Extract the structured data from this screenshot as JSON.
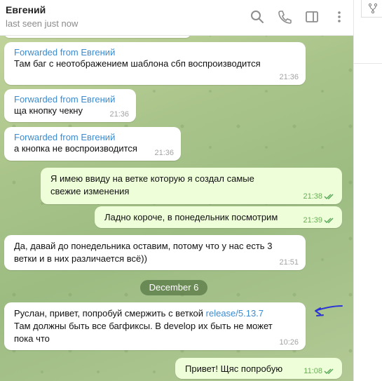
{
  "header": {
    "name": "Евгений",
    "status": "last seen just now"
  },
  "date_separator": "December 6",
  "messages": [
    {
      "forward": "Forwarded from Евгений",
      "text": "Там баг с неотображением шаблона сбп воспроизводится",
      "time": "21:36"
    },
    {
      "forward": "Forwarded from Евгений",
      "text": "ща кнопку чекну",
      "time": "21:36"
    },
    {
      "forward": "Forwarded from Евгений",
      "text": "а кнопка не воспроизводится",
      "time": "21:36"
    },
    {
      "text": "Я имею ввиду на ветке которую я создал самые свежие изменения",
      "time": "21:38"
    },
    {
      "text": "Ладно короче, в понедельник посмотрим",
      "time": "21:39"
    },
    {
      "text": "Да, давай до понедельника оставим, потому что у нас есть 3 ветки и в них различается всё))",
      "time": "21:51"
    },
    {
      "text_before_link": "Руслан, привет, попробуй смержить с веткой ",
      "link": "release/5.13.7",
      "text_after_link": "Там должны быть все багфиксы. В develop их быть не может пока что",
      "time": "10:26"
    },
    {
      "text": "Привет! Щяс попробую",
      "time": "11:08"
    }
  ],
  "colors": {
    "accent": "#3a8bd0",
    "outgoing": "#eefed9",
    "ink": "#2b35d6"
  }
}
